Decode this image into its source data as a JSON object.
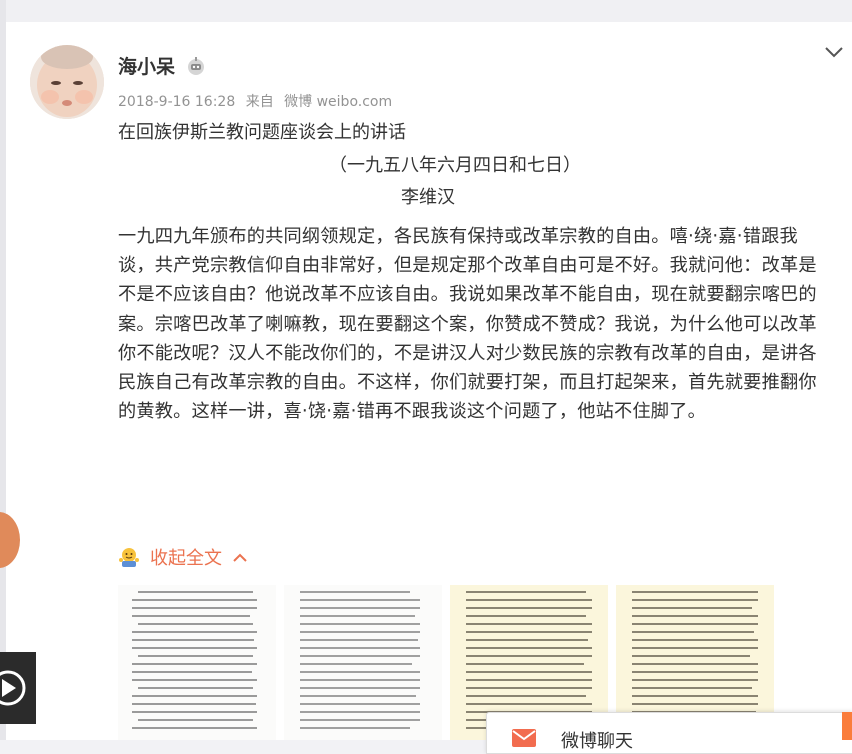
{
  "user": {
    "name": "海小呆"
  },
  "meta": {
    "datetime": "2018-9-16 16:28",
    "from_label": "来自",
    "source": "微博 weibo.com"
  },
  "post": {
    "title": "在回族伊斯兰教问题座谈会上的讲话",
    "date": "（一九五八年六月四日和七日）",
    "author": "李维汉",
    "body": "一九四九年颁布的共同纲领规定，各民族有保持或改革宗教的自由。嘻·绕·嘉·错跟我谈，共产党宗教信仰自由非常好，但是规定那个改革自由可是不好。我就问他：改革是不是不应该自由？他说改革不应该自由。我说如果改革不能自由，现在就要翻宗喀巴的案。宗喀巴改革了喇嘛教，现在要翻这个案，你赞成不赞成？我说，为什么他可以改革你不能改呢？汉人不能改你们的，不是讲汉人对少数民族的宗教有改革的自由，是讲各民族自己有改革宗教的自由。不这样，你们就要打架，而且打起架来，首先就要推翻你的黄教。这样一讲，喜·饶·嘉·错再不跟我谈这个问题了，他站不住脚了。"
  },
  "actions": {
    "collapse_label": "收起全文"
  },
  "chat": {
    "label": "微博聊天"
  },
  "colors": {
    "accent": "#eb7350",
    "meta": "#939393"
  }
}
